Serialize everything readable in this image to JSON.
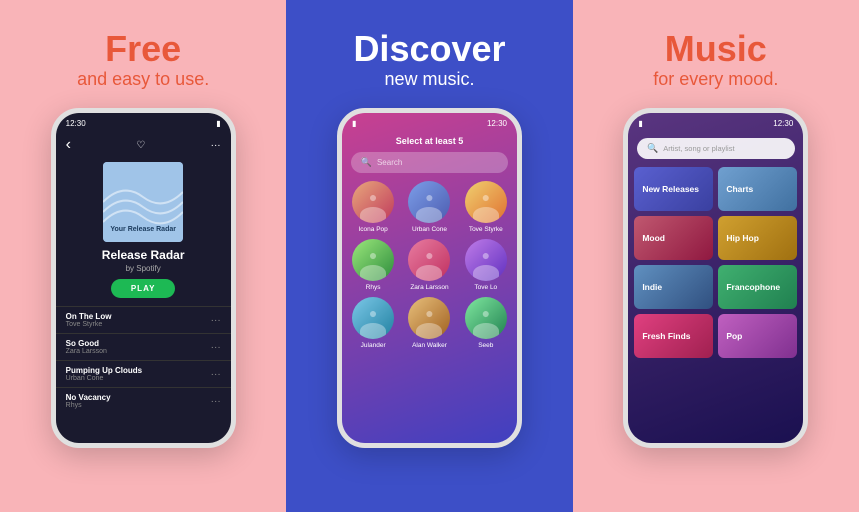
{
  "panels": [
    {
      "id": "left",
      "headline1": "Free",
      "headline2": "and easy to use.",
      "phone": {
        "status_time": "12:30",
        "album_label": "Your Release Radar",
        "title": "Release Radar",
        "artist": "by Spotify",
        "play_label": "PLAY",
        "tracks": [
          {
            "name": "On The Low",
            "artist": "Tove Styrke"
          },
          {
            "name": "So Good",
            "artist": "Zara Larsson"
          },
          {
            "name": "Pumping Up Clouds",
            "artist": "Urban Cone"
          },
          {
            "name": "No Vacancy",
            "artist": "Rhys"
          }
        ]
      }
    },
    {
      "id": "center",
      "headline1": "Discover",
      "headline2": "new music.",
      "phone": {
        "status_time": "12:30",
        "prompt": "Select at least 5",
        "search_placeholder": "Search",
        "artists": [
          {
            "name": "Icona Pop"
          },
          {
            "name": "Urban Cone"
          },
          {
            "name": "Tove Styrke"
          },
          {
            "name": "Rhys"
          },
          {
            "name": "Zara Larsson"
          },
          {
            "name": "Tove Lo"
          },
          {
            "name": "Julander"
          },
          {
            "name": "Alan Walker"
          },
          {
            "name": "Seeb"
          }
        ]
      }
    },
    {
      "id": "right",
      "headline1": "Music",
      "headline2": "for every mood.",
      "phone": {
        "status_time": "12:30",
        "search_placeholder": "Artist, song or playlist",
        "categories": [
          {
            "label": "New Releases",
            "class": "bc-new"
          },
          {
            "label": "Charts",
            "class": "bc-charts"
          },
          {
            "label": "Mood",
            "class": "bc-mood"
          },
          {
            "label": "Hip Hop",
            "class": "bc-hiphop"
          },
          {
            "label": "Indie",
            "class": "bc-indie"
          },
          {
            "label": "Francophone",
            "class": "bc-franco"
          },
          {
            "label": "Fresh Finds",
            "class": "bc-fresh"
          },
          {
            "label": "Pop",
            "class": "bc-pop"
          }
        ]
      }
    }
  ]
}
